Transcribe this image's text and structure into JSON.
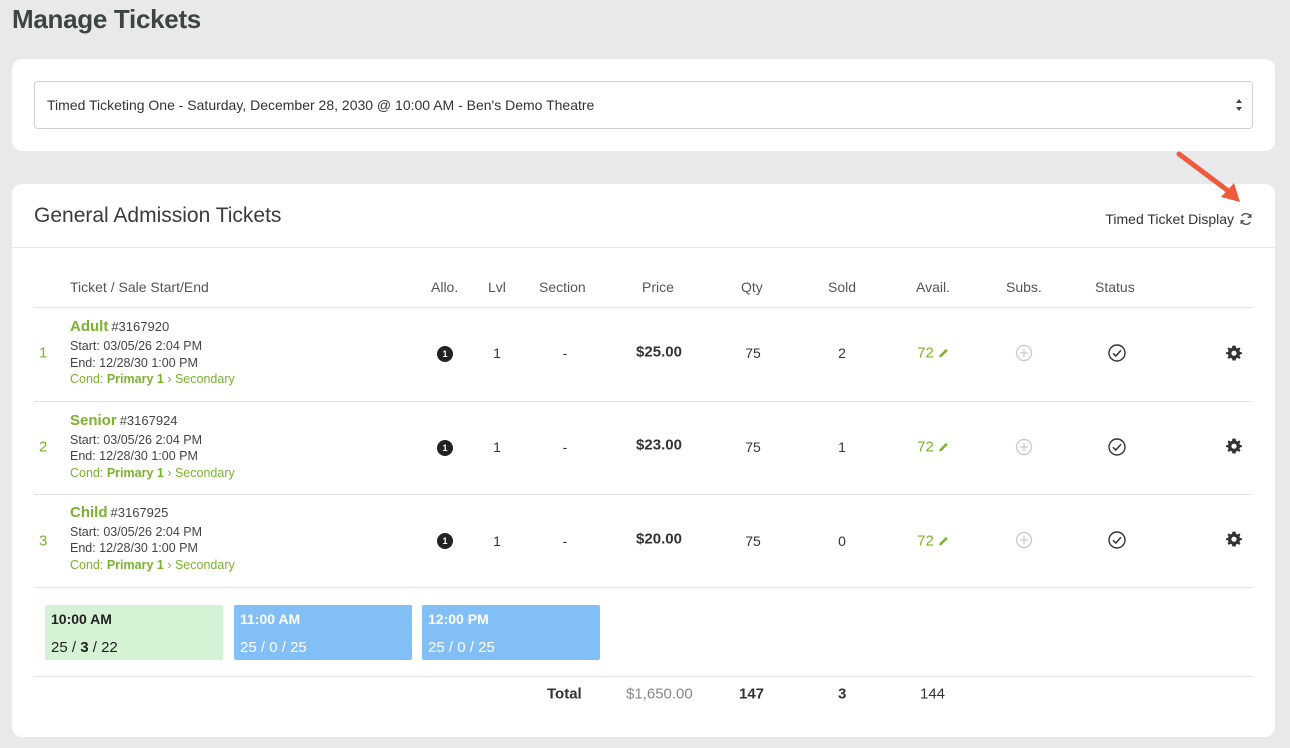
{
  "page": {
    "title": "Manage Tickets"
  },
  "event_select": {
    "value": "Timed Ticketing One - Saturday, December 28, 2030 @ 10:00 AM - Ben's Demo Theatre"
  },
  "section": {
    "title": "General Admission Tickets",
    "timed_display_label": "Timed Ticket Display"
  },
  "columns": {
    "ticket": "Ticket / Sale Start/End",
    "allo": "Allo.",
    "lvl": "Lvl",
    "section": "Section",
    "price": "Price",
    "qty": "Qty",
    "sold": "Sold",
    "avail": "Avail.",
    "subs": "Subs.",
    "status": "Status"
  },
  "tickets": [
    {
      "index": "1",
      "name": "Adult",
      "number": "#3167920",
      "start": "Start: 03/05/26 2:04 PM",
      "end": "End: 12/28/30 1:00 PM",
      "cond_label": "Cond:",
      "cond_primary": "Primary 1",
      "cond_secondary": "Secondary",
      "allo": "1",
      "lvl": "1",
      "section": "-",
      "price": "$25.00",
      "qty": "75",
      "sold": "2",
      "avail": "72"
    },
    {
      "index": "2",
      "name": "Senior",
      "number": "#3167924",
      "start": "Start: 03/05/26 2:04 PM",
      "end": "End: 12/28/30 1:00 PM",
      "cond_label": "Cond:",
      "cond_primary": "Primary 1",
      "cond_secondary": "Secondary",
      "allo": "1",
      "lvl": "1",
      "section": "-",
      "price": "$23.00",
      "qty": "75",
      "sold": "1",
      "avail": "72"
    },
    {
      "index": "3",
      "name": "Child",
      "number": "#3167925",
      "start": "Start: 03/05/26 2:04 PM",
      "end": "End: 12/28/30 1:00 PM",
      "cond_label": "Cond:",
      "cond_primary": "Primary 1",
      "cond_secondary": "Secondary",
      "allo": "1",
      "lvl": "1",
      "section": "-",
      "price": "$20.00",
      "qty": "75",
      "sold": "0",
      "avail": "72"
    }
  ],
  "time_slots": [
    {
      "time": "10:00 AM",
      "a": "25",
      "b": "3",
      "c": "22",
      "sep": " / ",
      "active": true
    },
    {
      "time": "11:00 AM",
      "a": "25",
      "b": "0",
      "c": "25",
      "sep": " / ",
      "active": false
    },
    {
      "time": "12:00 PM",
      "a": "25",
      "b": "0",
      "c": "25",
      "sep": " / ",
      "active": false
    }
  ],
  "totals": {
    "label": "Total",
    "price": "$1,650.00",
    "qty": "147",
    "sold": "3",
    "avail": "144"
  },
  "colors": {
    "accent_green": "#7ab32e",
    "slot_active": "#d6f2d4",
    "slot_other": "#82bff7",
    "arrow": "#f05a3c"
  }
}
